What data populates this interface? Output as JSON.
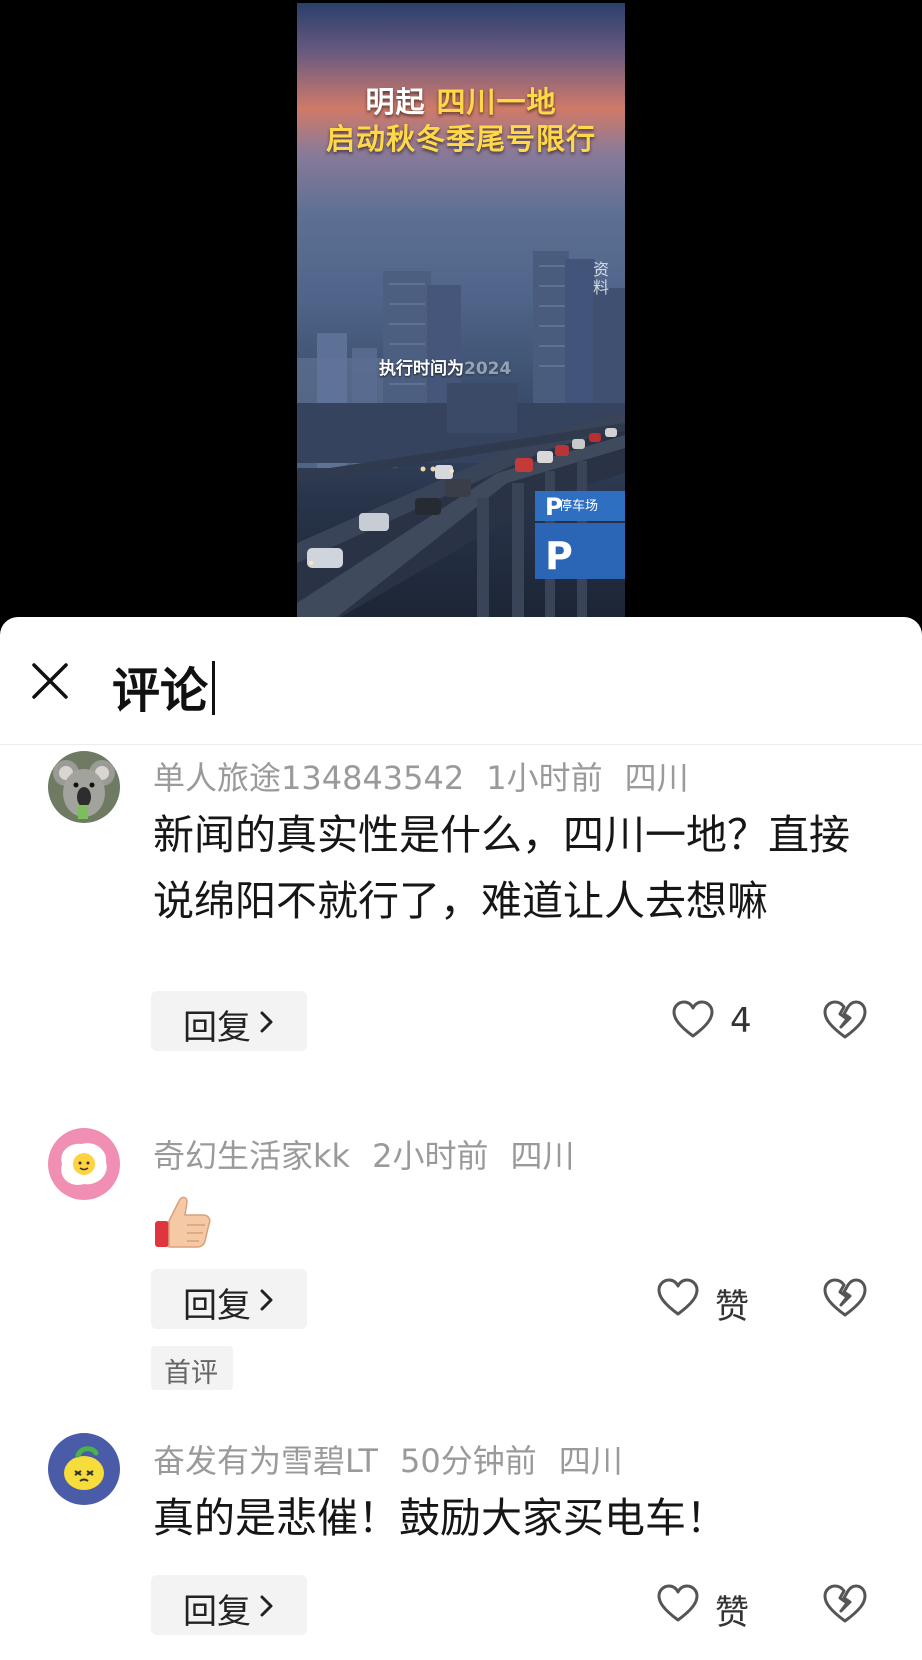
{
  "video": {
    "headline_line1_a": "明起 ",
    "headline_line1_b": "四川一地",
    "headline_line2": "启动秋冬季尾号限行",
    "subtitle_main": "执行时间为",
    "subtitle_fade": "2024",
    "watermark": "资料",
    "parking_label": "停车场"
  },
  "sheet": {
    "title": "评论",
    "close_icon": "close-icon"
  },
  "comments": [
    {
      "username": "单人旅途134843542",
      "time": "1小时前",
      "location": "四川",
      "text": "新闻的真实性是什么，四川一地？直接说绵阳不就行了，难道让人去想嘛",
      "reply_label": "回复",
      "like_label": "4",
      "avatar_icon": "koala-avatar"
    },
    {
      "username": "奇幻生活家kk",
      "time": "2小时前",
      "location": "四川",
      "text": "",
      "emoji_icon": "thumbs-up-emoji",
      "reply_label": "回复",
      "like_label": "赞",
      "badge": "首评",
      "avatar_icon": "fried-egg-avatar"
    },
    {
      "username": "奋发有为雪碧LT",
      "time": "50分钟前",
      "location": "四川",
      "text": "真的是悲催！鼓励大家买电车！",
      "reply_label": "回复",
      "like_label": "赞",
      "avatar_icon": "lemon-avatar"
    }
  ],
  "colors": {
    "meta_text": "#9a9a9a",
    "headline_highlight": "#ffd84a",
    "reply_bg": "#f3f3f3"
  }
}
